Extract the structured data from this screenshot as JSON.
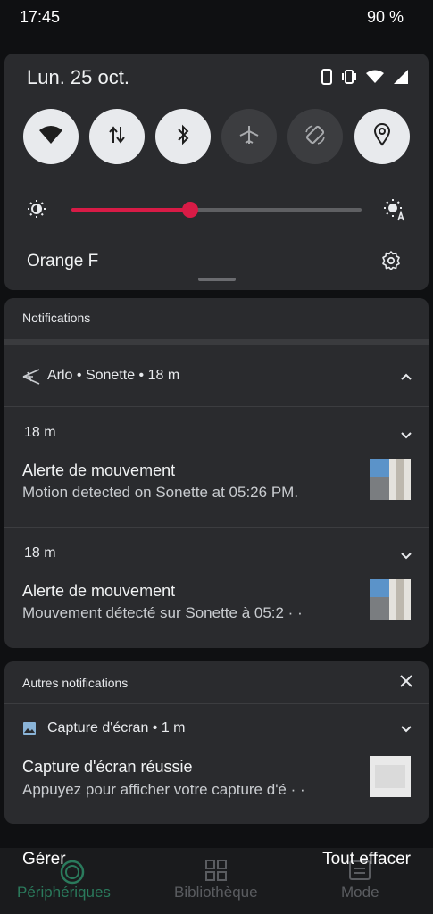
{
  "status_bar": {
    "time": "17:45",
    "battery": "90 %"
  },
  "quick_settings": {
    "date": "Lun. 25 oct.",
    "carrier": "Orange F",
    "brightness": 0.41,
    "tiles": [
      {
        "icon": "wifi-icon",
        "state": "on"
      },
      {
        "icon": "mobile-data-icon",
        "state": "on"
      },
      {
        "icon": "bluetooth-icon",
        "state": "on"
      },
      {
        "icon": "airplane-mode-icon",
        "state": "off"
      },
      {
        "icon": "auto-rotate-icon",
        "state": "off"
      },
      {
        "icon": "location-icon",
        "state": "on"
      }
    ],
    "accent_color": "#d81b46"
  },
  "notifications": {
    "header": "Notifications",
    "app_row": "Arlo • Sonette • 18 m",
    "items": [
      {
        "time": "18 m",
        "title": "Alerte de mouvement",
        "body": "Motion detected on Sonette at 05:26 PM."
      },
      {
        "time": "18 m",
        "title": "Alerte de mouvement",
        "body": "Mouvement détecté sur Sonette à 05:2 · ·"
      }
    ]
  },
  "other_notifications": {
    "header": "Autres notifications",
    "app_row": "Capture d'écran • 1 m",
    "title": "Capture d'écran réussie",
    "body": "Appuyez pour afficher votre capture d'é · ·"
  },
  "bottom": {
    "manage_label": "Gérer",
    "clear_all_label": "Tout effacer",
    "nav": [
      {
        "label": "Périphériques",
        "icon": "devices-icon",
        "active": true
      },
      {
        "label": "Bibliothèque",
        "icon": "library-grid-icon",
        "active": false
      },
      {
        "label": "Mode",
        "icon": "mode-icon",
        "active": false
      }
    ]
  }
}
